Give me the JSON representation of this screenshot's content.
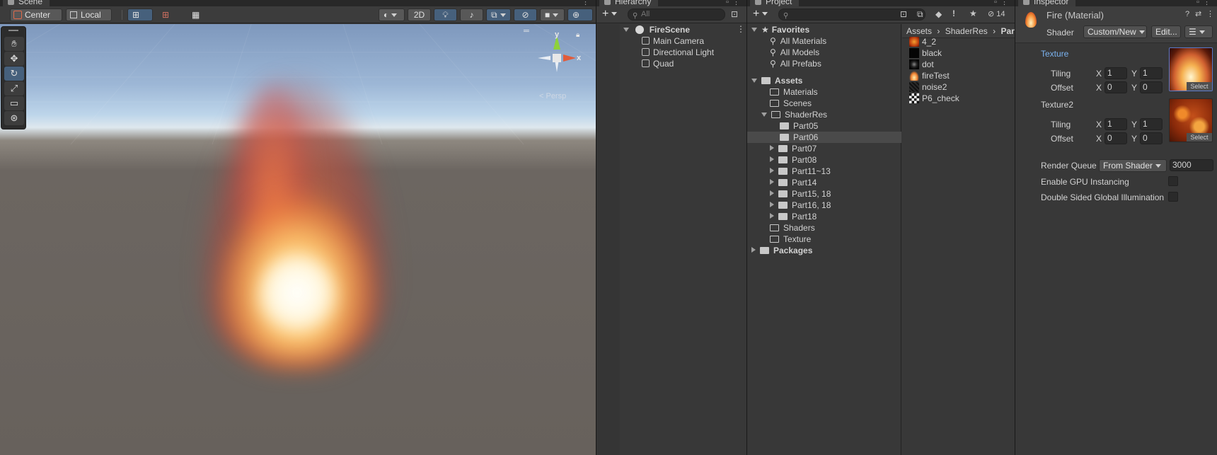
{
  "scene": {
    "tab": "Scene",
    "toolbar": {
      "pivot": "Center",
      "space": "Local",
      "mode_2d": "2D"
    },
    "gizmo": {
      "y": "y",
      "x": "x",
      "persp": "< Persp"
    },
    "tools": [
      "hand-tool",
      "move-tool",
      "rotate-tool",
      "scale-tool",
      "rect-tool",
      "transform-tool"
    ]
  },
  "hierarchy": {
    "tab": "Hierarchy",
    "search_placeholder": "All",
    "scene_name": "FireScene",
    "objects": [
      "Main Camera",
      "Directional Light",
      "Quad"
    ]
  },
  "project": {
    "tab": "Project",
    "hidden_count": "14",
    "favorites": {
      "label": "Favorites",
      "items": [
        "All Materials",
        "All Models",
        "All Prefabs"
      ]
    },
    "assets": {
      "label": "Assets",
      "folders": [
        "Materials",
        "Scenes"
      ],
      "shaderres": {
        "label": "ShaderRes",
        "children": [
          "Part05",
          "Part06",
          "Part07",
          "Part08",
          "Part11~13",
          "Part14",
          "Part15, 18",
          "Part16, 18",
          "Part18"
        ]
      },
      "more_folders": [
        "Shaders",
        "Texture"
      ]
    },
    "packages": "Packages",
    "breadcrumb": [
      "Assets",
      "ShaderRes",
      "Par"
    ],
    "files": [
      "4_2",
      "black",
      "dot",
      "fireTest",
      "noise2",
      "P6_check"
    ]
  },
  "inspector": {
    "tab": "Inspector",
    "title": "Fire (Material)",
    "shader_label": "Shader",
    "shader_value": "Custom/New",
    "edit_label": "Edit...",
    "texture1": {
      "label": "Texture",
      "tiling_label": "Tiling",
      "offset_label": "Offset",
      "tiling_x": "1",
      "tiling_y": "1",
      "offset_x": "0",
      "offset_y": "0",
      "select": "Select"
    },
    "texture2": {
      "label": "Texture2",
      "tiling_label": "Tiling",
      "offset_label": "Offset",
      "tiling_x": "1",
      "tiling_y": "1",
      "offset_x": "0",
      "offset_y": "0",
      "select": "Select"
    },
    "axis_x": "X",
    "axis_y": "Y",
    "render_queue_label": "Render Queue",
    "render_queue_mode": "From Shader",
    "render_queue_value": "3000",
    "gpu_instancing_label": "Enable GPU Instancing",
    "double_sided_label": "Double Sided Global Illumination",
    "colors": {
      "accent": "#7bb3f0",
      "selection": "#46607c"
    }
  }
}
